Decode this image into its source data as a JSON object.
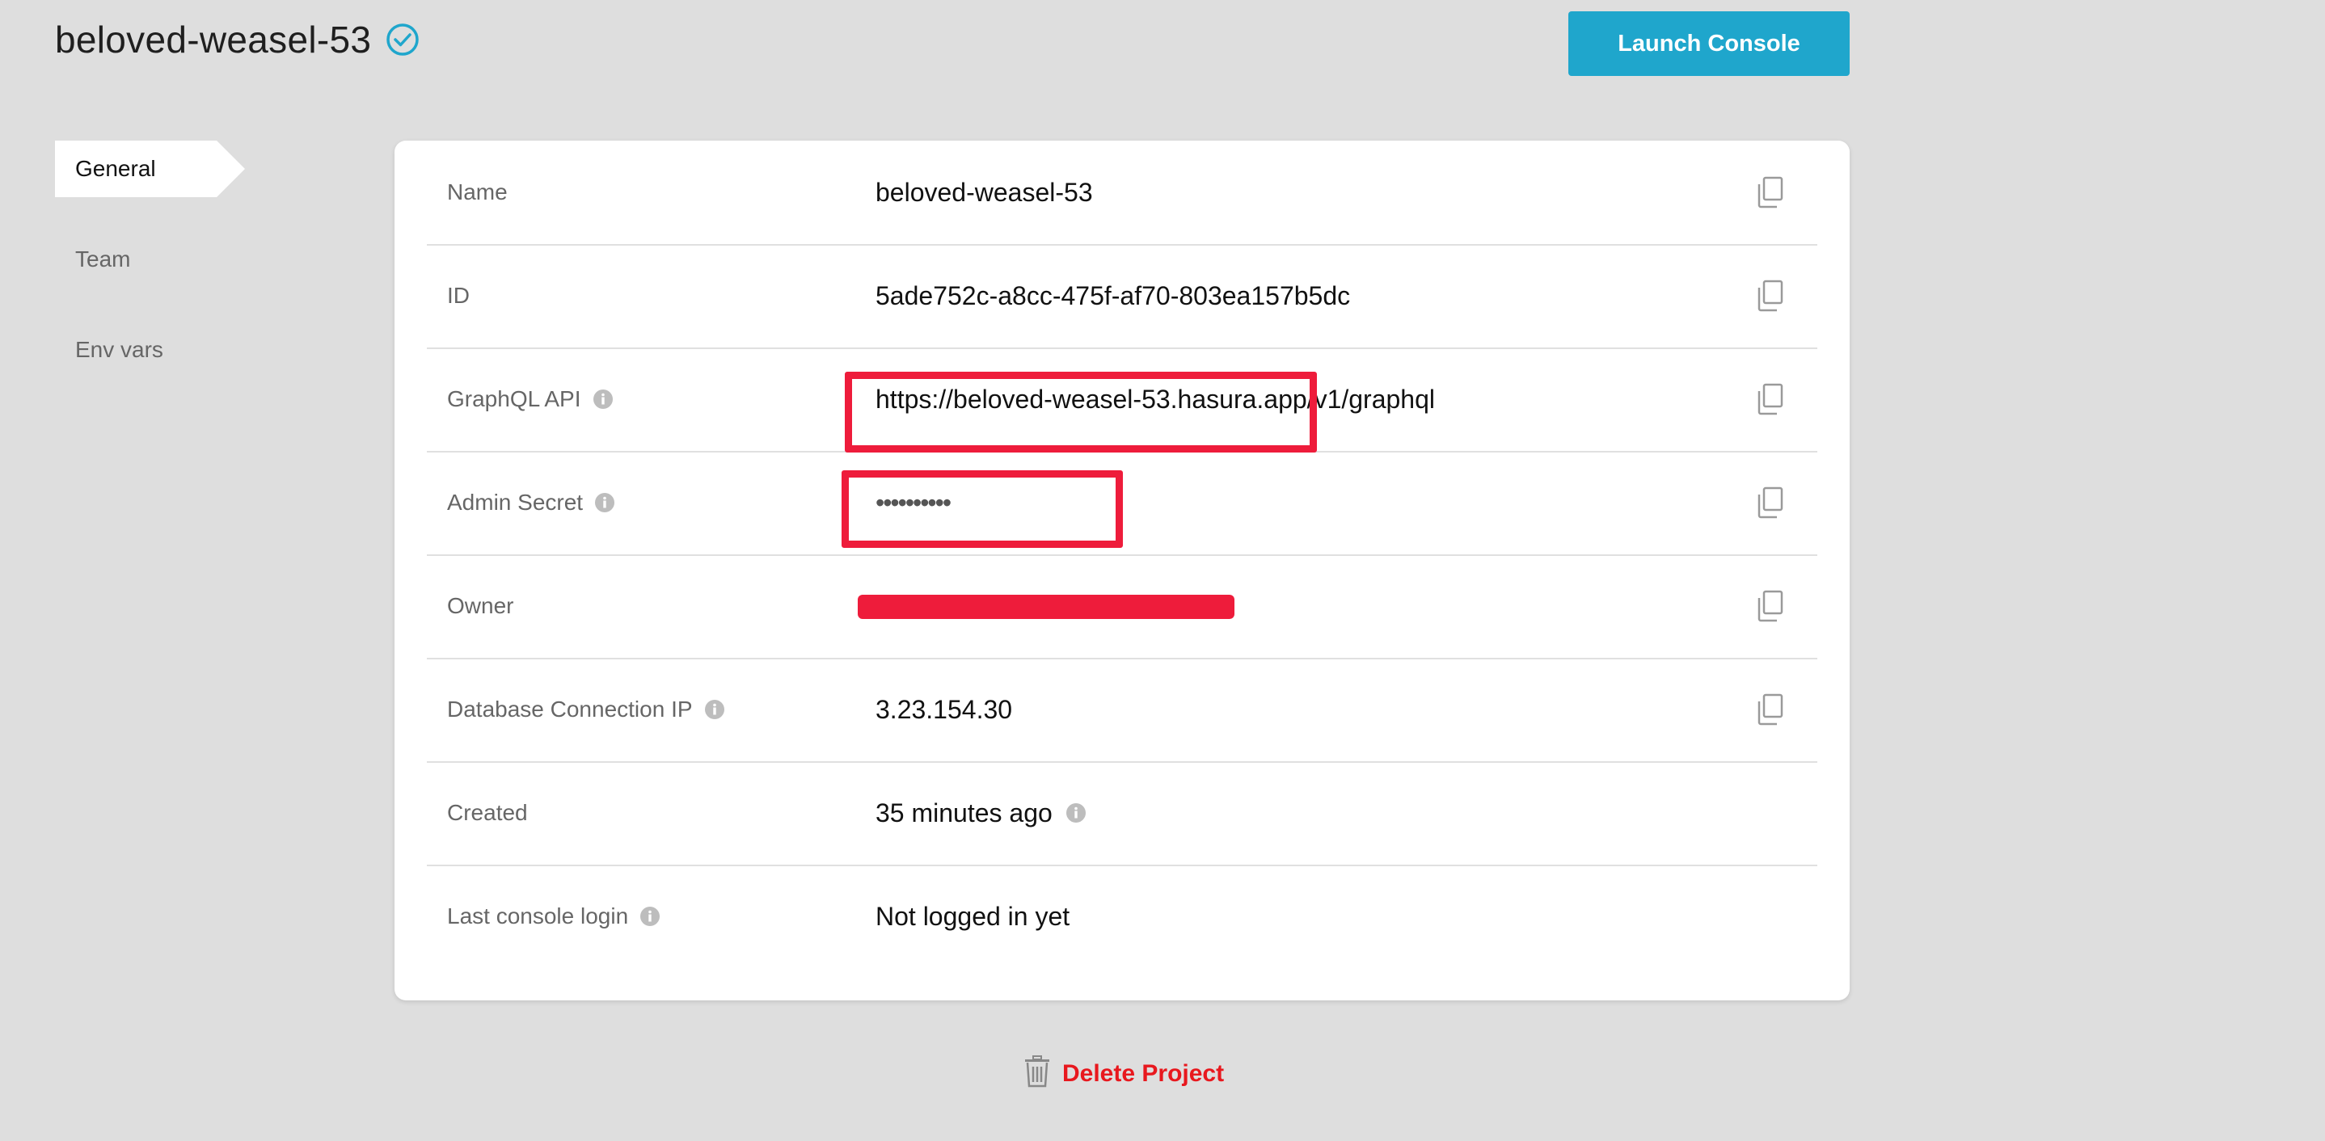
{
  "project": {
    "title": "beloved-weasel-53",
    "launch_label": "Launch Console"
  },
  "sidebar": {
    "items": [
      {
        "label": "General",
        "active": true
      },
      {
        "label": "Team",
        "active": false
      },
      {
        "label": "Env vars",
        "active": false
      }
    ]
  },
  "details": {
    "rows": [
      {
        "label": "Name",
        "value": "beloved-weasel-53",
        "info": false,
        "copy": true
      },
      {
        "label": "ID",
        "value": "5ade752c-a8cc-475f-af70-803ea157b5dc",
        "info": false,
        "copy": true
      },
      {
        "label": "GraphQL API",
        "value": "https://beloved-weasel-53.hasura.app/v1/graphql",
        "info": true,
        "copy": true
      },
      {
        "label": "Admin Secret",
        "value": "••••••••••",
        "info": true,
        "copy": true
      },
      {
        "label": "Owner",
        "value": "",
        "info": false,
        "copy": true
      },
      {
        "label": "Database Connection IP",
        "value": "3.23.154.30",
        "info": true,
        "copy": true
      },
      {
        "label": "Created",
        "value": "35 minutes ago",
        "info": false,
        "copy": false
      },
      {
        "label": "Last console login",
        "value": "Not logged in yet",
        "info": true,
        "copy": false
      }
    ]
  },
  "delete": {
    "label": "Delete Project"
  },
  "colors": {
    "accent": "#1fa6cc",
    "danger": "#e8181e",
    "highlight": "#ee1c3b",
    "background": "#dedede"
  },
  "icons": {
    "verified": "check-circle-icon",
    "info": "info-icon",
    "copy": "copy-icon",
    "delete": "trash-icon"
  }
}
